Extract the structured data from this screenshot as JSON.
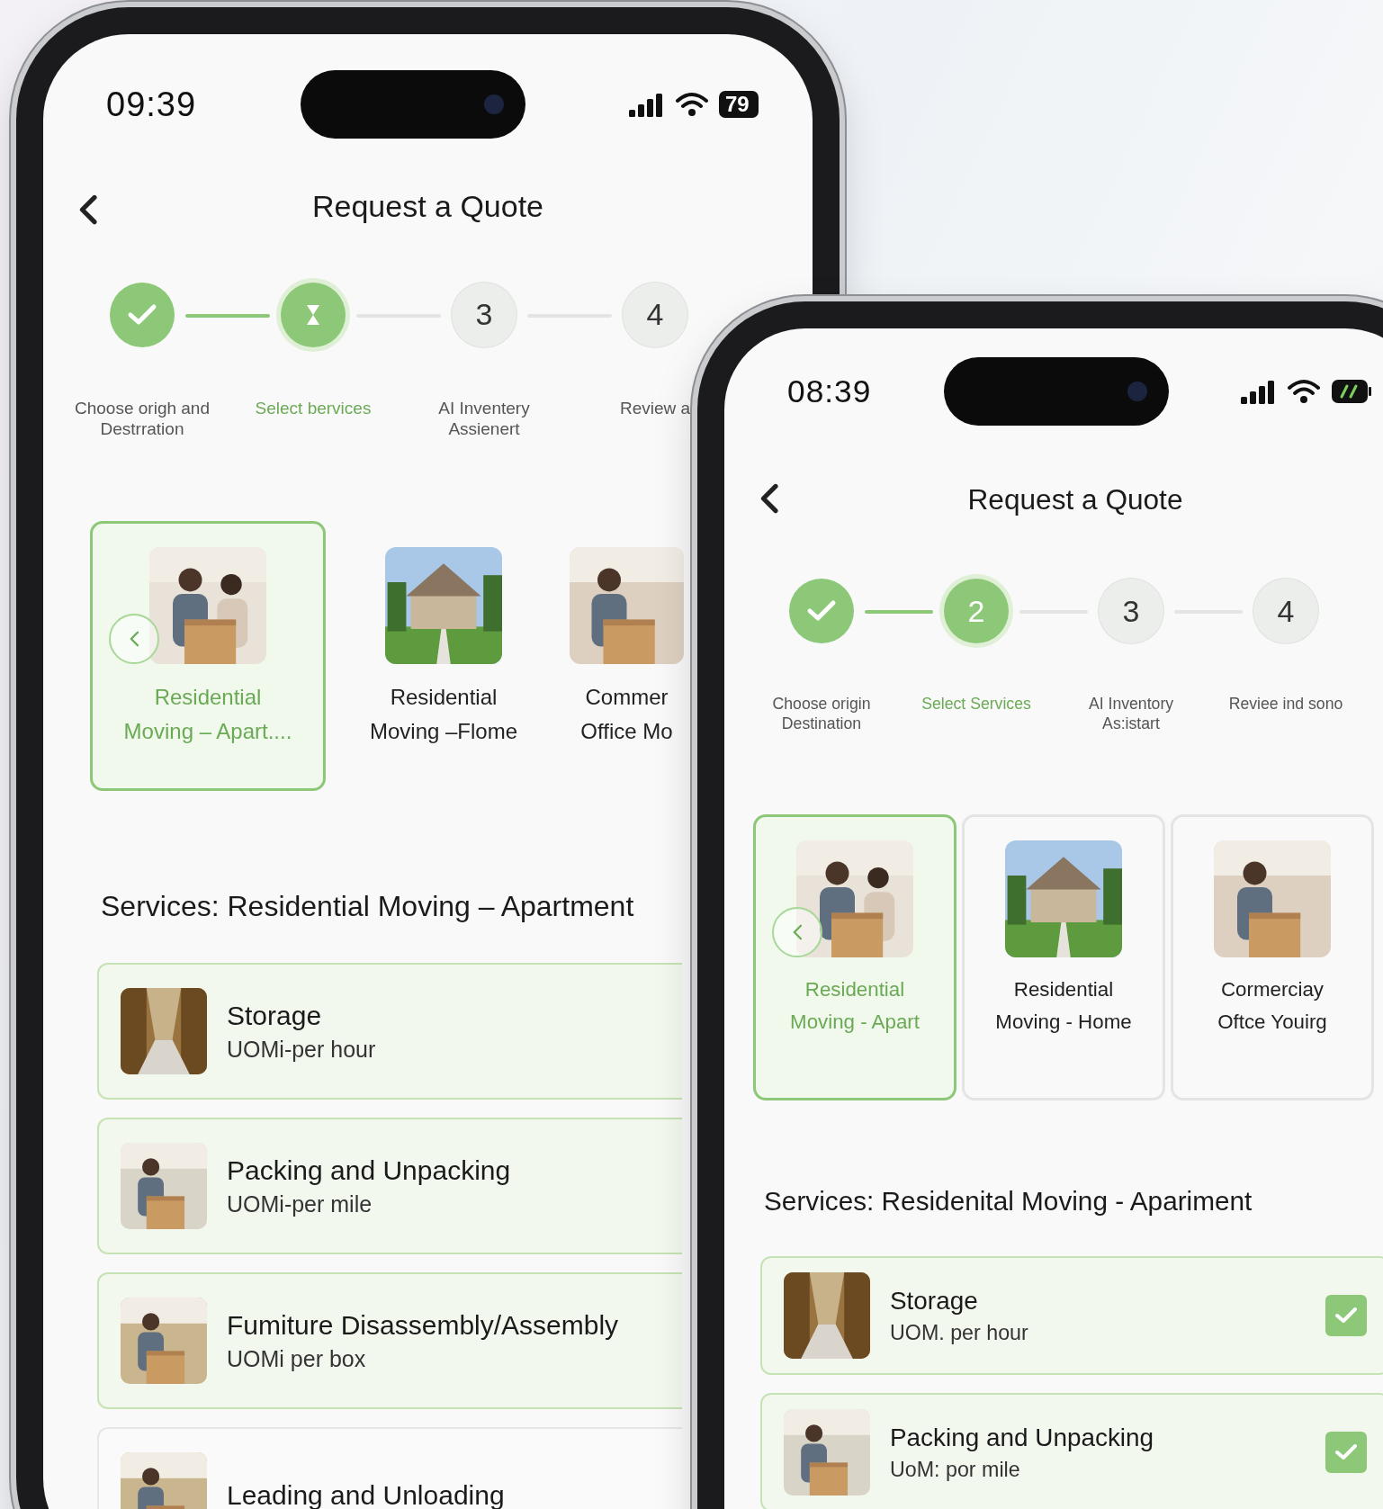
{
  "phones": [
    {
      "status": {
        "time": "09:39",
        "battery": "79"
      },
      "title": "Request a Quote",
      "steps": [
        {
          "label": "Choose origh and\nDestrration",
          "completed": true,
          "selected": false
        },
        {
          "label": "Select bervices",
          "completed": false,
          "selected": true
        },
        {
          "number": "3",
          "label": "AI Inventery\nAssienert",
          "completed": false,
          "selected": false
        },
        {
          "number": "4",
          "label": "Review a",
          "completed": false,
          "selected": false
        }
      ],
      "categories": [
        {
          "title": "Residential",
          "subtitle": "Moving – Apart....",
          "selected": true
        },
        {
          "title": "Residential",
          "subtitle": "Moving –Flome",
          "selected": false
        },
        {
          "title": "Commer",
          "subtitle": "Office Mo",
          "selected": false
        }
      ],
      "section_title": "Services: Residential Moving – Apartment",
      "services": [
        {
          "name": "Storage",
          "unit": "UOMi-per hour",
          "selected": true
        },
        {
          "name": "Packing and Unpacking",
          "unit": "UOMi-per mile",
          "selected": true
        },
        {
          "name": "Fumiture Disassembly/Assembly",
          "unit": "UOMi per box",
          "selected": true
        },
        {
          "name": "Leading and Unloading",
          "selected": false
        }
      ]
    },
    {
      "status": {
        "time": "08:39"
      },
      "title": "Request a Quote",
      "steps": [
        {
          "label": "Choose origin\nDestination",
          "completed": true,
          "selected": false
        },
        {
          "number": "2",
          "label": "Select Services",
          "completed": false,
          "selected": true
        },
        {
          "number": "3",
          "label": "AI Inventory\nAs:istart",
          "completed": false,
          "selected": false
        },
        {
          "number": "4",
          "label": "Reviee ind sono",
          "completed": false,
          "selected": false
        }
      ],
      "categories": [
        {
          "title": "Residential",
          "subtitle": "Moving - Apart",
          "selected": true
        },
        {
          "title": "Residential",
          "subtitle": "Moving - Home",
          "selected": false
        },
        {
          "title": "Cormerciay",
          "subtitle": "Oftce Youirg",
          "selected": false
        }
      ],
      "section_title": "Services: Residenital Moving - Apariment",
      "services": [
        {
          "name": "Storage",
          "unit": "UOM. per hour",
          "selected": true,
          "checked": true
        },
        {
          "name": "Packing and Unpacking",
          "unit": "UoM: por mile",
          "selected": true,
          "checked": true
        }
      ]
    }
  ]
}
